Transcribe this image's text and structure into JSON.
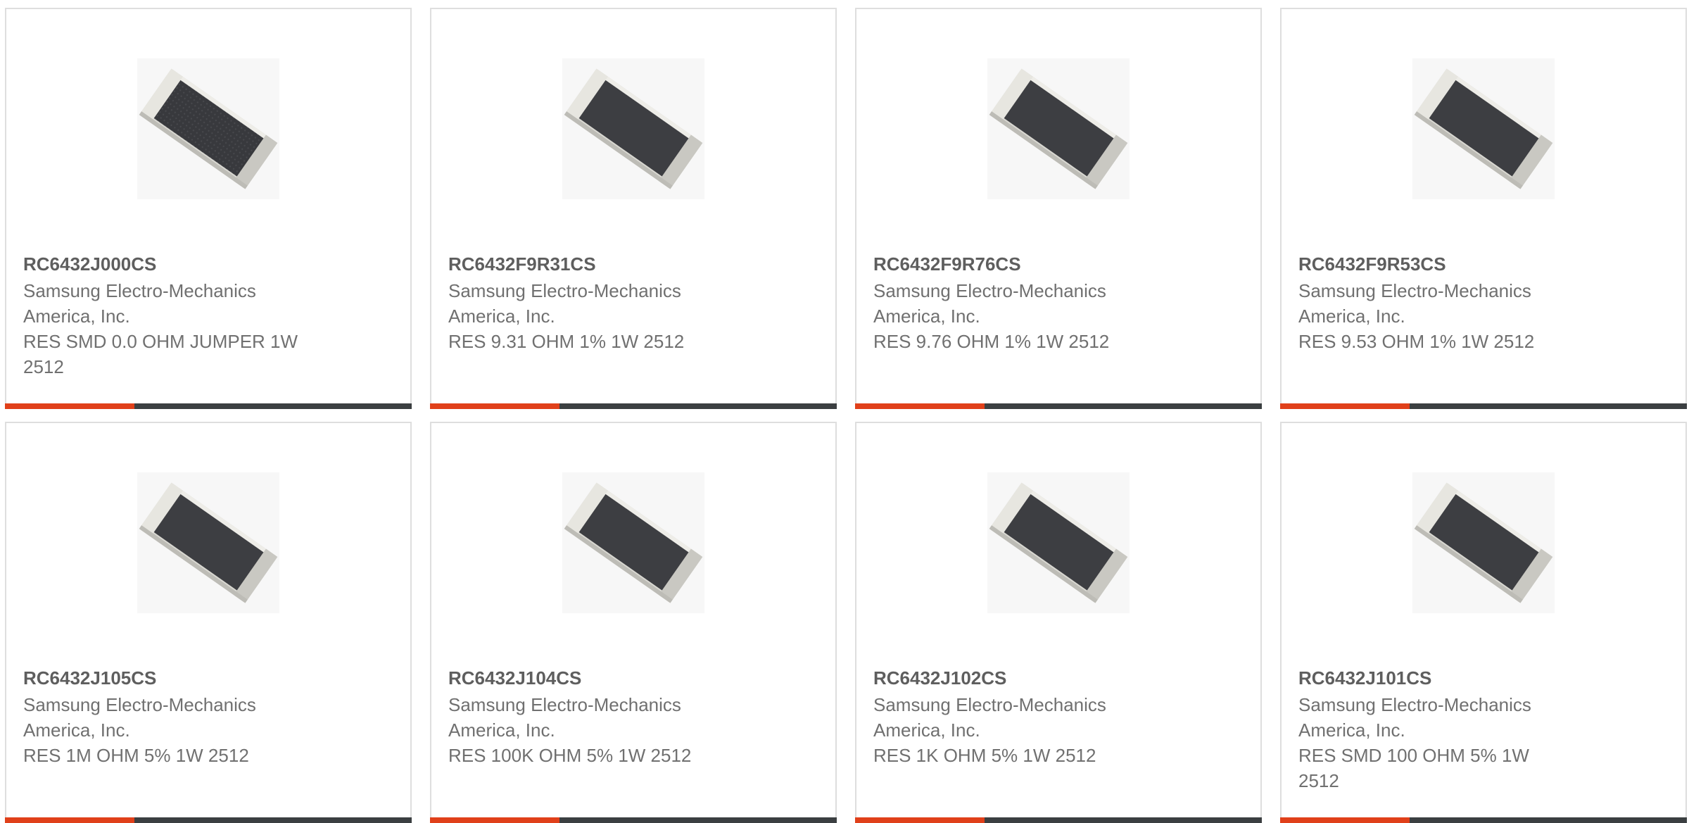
{
  "colors": {
    "accent": "#e0401a",
    "bar": "#3b3f41",
    "border": "#dedede",
    "text": "#707070"
  },
  "products": [
    {
      "part_number": "RC6432J000CS",
      "manufacturer_line1": "Samsung Electro-Mechanics",
      "manufacturer_line2": "America, Inc.",
      "description_line1": "RES SMD 0.0 OHM JUMPER 1W",
      "description_line2": "2512",
      "image_icon": "smd-resistor-image"
    },
    {
      "part_number": "RC6432F9R31CS",
      "manufacturer_line1": "Samsung Electro-Mechanics",
      "manufacturer_line2": "America, Inc.",
      "description_line1": "RES 9.31 OHM 1% 1W 2512",
      "description_line2": "",
      "image_icon": "smd-resistor-image"
    },
    {
      "part_number": "RC6432F9R76CS",
      "manufacturer_line1": "Samsung Electro-Mechanics",
      "manufacturer_line2": "America, Inc.",
      "description_line1": "RES 9.76 OHM 1% 1W 2512",
      "description_line2": "",
      "image_icon": "smd-resistor-image"
    },
    {
      "part_number": "RC6432F9R53CS",
      "manufacturer_line1": "Samsung Electro-Mechanics",
      "manufacturer_line2": "America, Inc.",
      "description_line1": "RES 9.53 OHM 1% 1W 2512",
      "description_line2": "",
      "image_icon": "smd-resistor-image"
    },
    {
      "part_number": "RC6432J105CS",
      "manufacturer_line1": "Samsung Electro-Mechanics",
      "manufacturer_line2": "America, Inc.",
      "description_line1": "RES 1M OHM 5% 1W 2512",
      "description_line2": "",
      "image_icon": "smd-resistor-image"
    },
    {
      "part_number": "RC6432J104CS",
      "manufacturer_line1": "Samsung Electro-Mechanics",
      "manufacturer_line2": "America, Inc.",
      "description_line1": "RES 100K OHM 5% 1W 2512",
      "description_line2": "",
      "image_icon": "smd-resistor-image"
    },
    {
      "part_number": "RC6432J102CS",
      "manufacturer_line1": "Samsung Electro-Mechanics",
      "manufacturer_line2": "America, Inc.",
      "description_line1": "RES 1K OHM 5% 1W 2512",
      "description_line2": "",
      "image_icon": "smd-resistor-image"
    },
    {
      "part_number": "RC6432J101CS",
      "manufacturer_line1": "Samsung Electro-Mechanics",
      "manufacturer_line2": "America, Inc.",
      "description_line1": "RES SMD 100 OHM 5% 1W",
      "description_line2": "2512",
      "image_icon": "smd-resistor-image"
    }
  ]
}
